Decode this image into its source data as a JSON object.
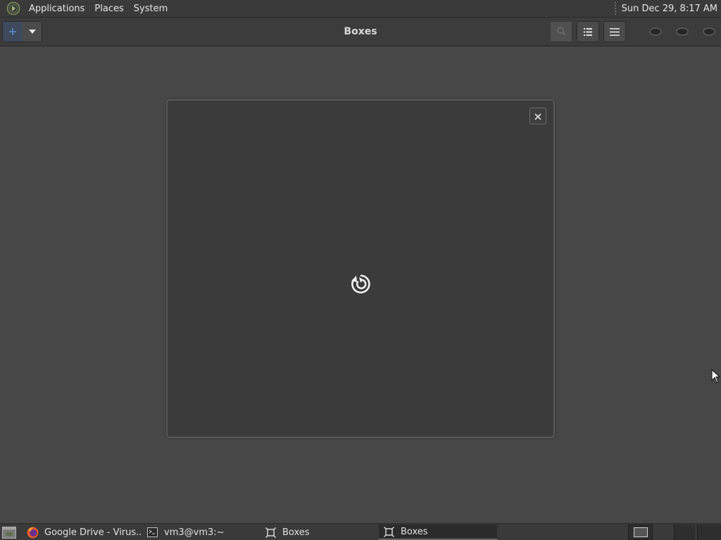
{
  "top_panel": {
    "logo_icon": "distro-logo-icon",
    "menus": [
      "Applications",
      "Places",
      "System"
    ],
    "clock": "Sun Dec 29,  8:17 AM"
  },
  "header_bar": {
    "title": "Boxes",
    "new_button_icon": "plus-icon",
    "new_dropdown_icon": "chevron-down-icon",
    "search_icon": "search-icon",
    "list_view_icon": "list-view-icon",
    "menu_icon": "hamburger-menu-icon",
    "window_controls": [
      "minimize",
      "maximize",
      "close"
    ]
  },
  "dialog": {
    "close_icon": "close-icon",
    "spinner_icon": "loading-spinner-icon"
  },
  "taskbar": {
    "tasks": [
      {
        "label": "Google Drive - Virus...",
        "icon": "firefox-icon"
      },
      {
        "label": "vm3@vm3:~",
        "icon": "terminal-icon"
      },
      {
        "label": "Boxes",
        "icon": "boxes-icon"
      },
      {
        "label": "Boxes",
        "icon": "boxes-icon",
        "active": true
      }
    ],
    "workspaces": 3
  },
  "colors": {
    "background": "#474747",
    "panel": "#3a3a3a",
    "dialog": "#3b3b3b",
    "accent_blue": "#5b8cd6"
  }
}
